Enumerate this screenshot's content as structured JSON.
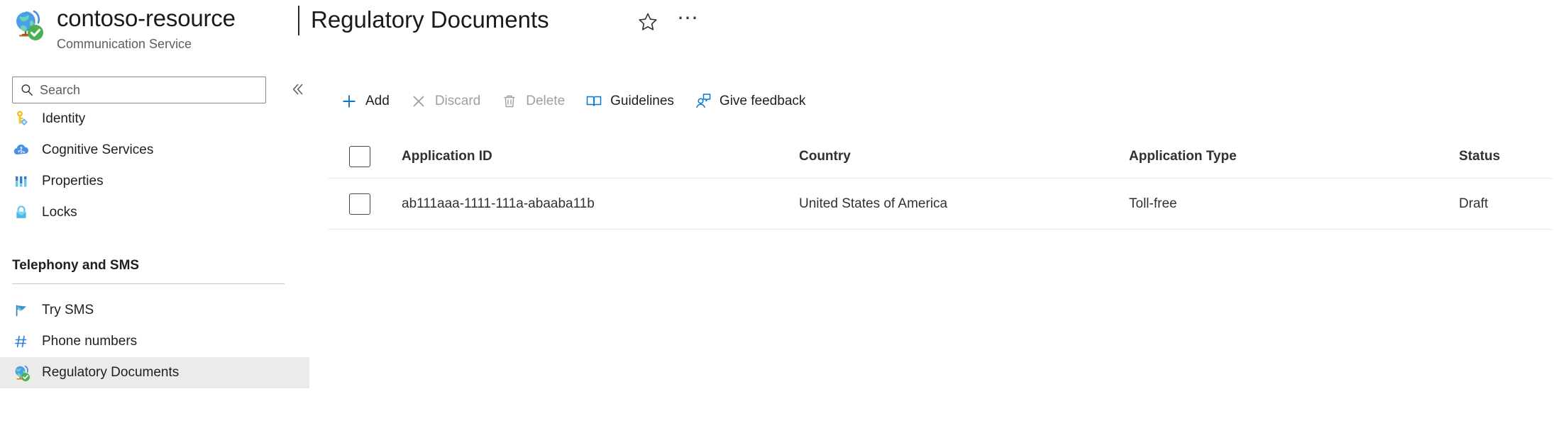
{
  "header": {
    "resource_name": "contoso-resource",
    "resource_type": "Communication Service",
    "separator": "|",
    "page_title": "Regulatory Documents",
    "favorite_icon": "star-icon",
    "more_icon": "ellipsis-icon",
    "resource_icon": "globe-check-icon"
  },
  "sidebar": {
    "search": {
      "placeholder": "Search",
      "value": "",
      "icon": "search-icon"
    },
    "collapse": {
      "label": "«",
      "icon": "chevron-double-left-icon"
    },
    "items": [
      {
        "label": "Identity",
        "icon": "key-identity-icon",
        "selected": false
      },
      {
        "label": "Cognitive Services",
        "icon": "cloud-cognitive-icon",
        "selected": false
      },
      {
        "label": "Properties",
        "icon": "properties-bars-icon",
        "selected": false
      },
      {
        "label": "Locks",
        "icon": "lock-icon",
        "selected": false
      }
    ],
    "section": {
      "title": "Telephony and SMS",
      "items": [
        {
          "label": "Try SMS",
          "icon": "flag-sms-icon",
          "selected": false
        },
        {
          "label": "Phone numbers",
          "icon": "hash-number-icon",
          "selected": false
        },
        {
          "label": "Regulatory Documents",
          "icon": "globe-check-icon",
          "selected": true
        }
      ]
    }
  },
  "toolbar": {
    "commands": [
      {
        "label": "Add",
        "icon": "plus-icon",
        "enabled": true
      },
      {
        "label": "Discard",
        "icon": "cross-icon",
        "enabled": false
      },
      {
        "label": "Delete",
        "icon": "trash-icon",
        "enabled": false
      },
      {
        "label": "Guidelines",
        "icon": "book-icon",
        "enabled": true
      },
      {
        "label": "Give feedback",
        "icon": "feedback-icon",
        "enabled": true
      }
    ]
  },
  "table": {
    "select_all_checked": false,
    "columns": [
      "Application ID",
      "Country",
      "Application Type",
      "Status"
    ],
    "rows": [
      {
        "checked": false,
        "application_id": "ab111aaa-1111-111a-abaaba11b",
        "country": "United States of America",
        "application_type": "Toll-free",
        "status": "Draft"
      }
    ]
  },
  "colors": {
    "accent_blue": "#0078d4",
    "disabled_gray": "#a19f9d",
    "selected_bg": "#edebe9",
    "text": "#201f1e",
    "border": "#8a8886"
  }
}
